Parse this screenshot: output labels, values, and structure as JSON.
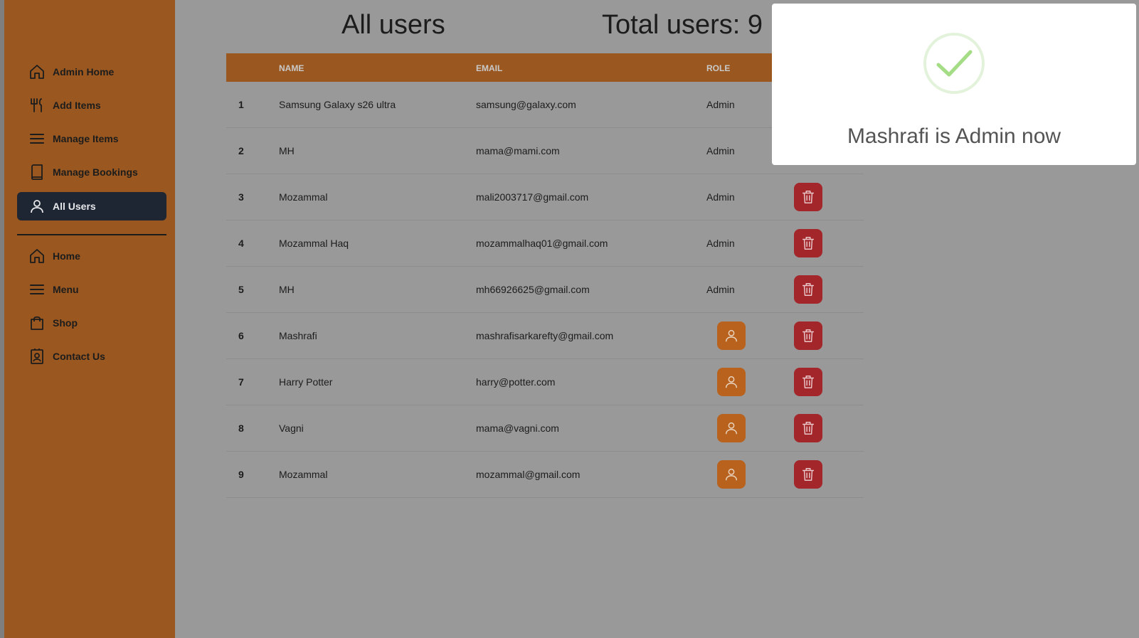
{
  "sidebar": {
    "admin_items": [
      {
        "label": "Admin Home",
        "icon": "home-icon"
      },
      {
        "label": "Add Items",
        "icon": "utensils-icon"
      },
      {
        "label": "Manage Items",
        "icon": "list-icon"
      },
      {
        "label": "Manage Bookings",
        "icon": "book-icon"
      },
      {
        "label": "All Users",
        "icon": "user-icon",
        "active": true
      }
    ],
    "site_items": [
      {
        "label": "Home",
        "icon": "home-icon"
      },
      {
        "label": "Menu",
        "icon": "list-icon"
      },
      {
        "label": "Shop",
        "icon": "shopping-bag-icon"
      },
      {
        "label": "Contact Us",
        "icon": "contact-card-icon"
      }
    ]
  },
  "header": {
    "title": "All users",
    "total_label": "Total users: 9"
  },
  "table": {
    "columns": [
      "",
      "NAME",
      "EMAIL",
      "ROLE"
    ],
    "rows": [
      {
        "index": "1",
        "name": "Samsung Galaxy s26 ultra",
        "email": "samsung@galaxy.com",
        "role": "Admin"
      },
      {
        "index": "2",
        "name": "MH",
        "email": "mama@mami.com",
        "role": "Admin"
      },
      {
        "index": "3",
        "name": "Mozammal",
        "email": "mali2003717@gmail.com",
        "role": "Admin"
      },
      {
        "index": "4",
        "name": "Mozammal Haq",
        "email": "mozammalhaq01@gmail.com",
        "role": "Admin"
      },
      {
        "index": "5",
        "name": "MH",
        "email": "mh66926625@gmail.com",
        "role": "Admin"
      },
      {
        "index": "6",
        "name": "Mashrafi",
        "email": "mashrafisarkarefty@gmail.com",
        "role": ""
      },
      {
        "index": "7",
        "name": "Harry Potter",
        "email": "harry@potter.com",
        "role": ""
      },
      {
        "index": "8",
        "name": "Vagni",
        "email": "mama@vagni.com",
        "role": ""
      },
      {
        "index": "9",
        "name": "Mozammal",
        "email": "mozammal@gmail.com",
        "role": ""
      }
    ]
  },
  "toast": {
    "message": "Mashrafi is Admin now",
    "icon": "success-check-icon"
  },
  "colors": {
    "sidebar_bg": "#9a5820",
    "overlay_bg": "#999999",
    "active_nav": "#1f2633",
    "make_admin_button": "#b8621e",
    "delete_button": "#a3262b",
    "success_check": "#a5dc86"
  }
}
